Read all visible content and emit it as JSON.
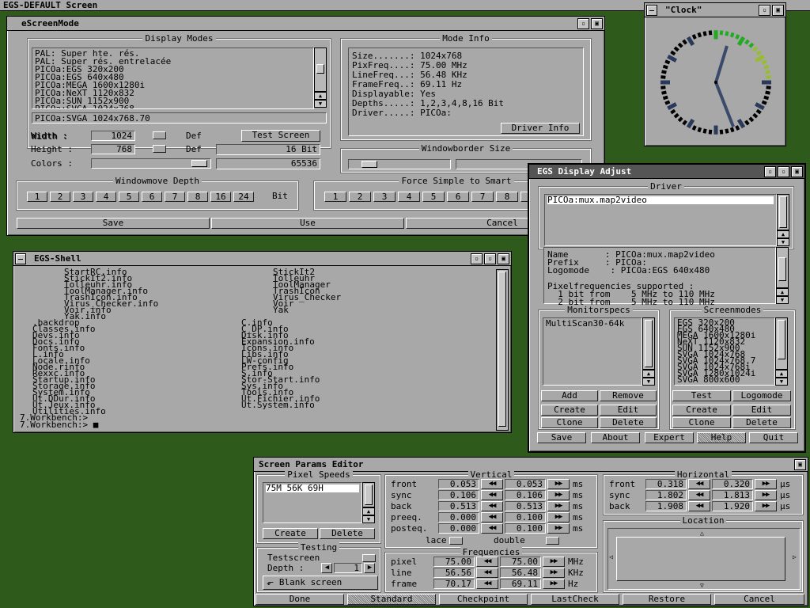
{
  "screen_title": "EGS-DEFAULT Screen",
  "escreenmode": {
    "title": "eScreenMode",
    "display_modes_label": "Display Modes",
    "modes": [
      "PAL: Super hte. rés.",
      "PAL: Super rés. entrelacée",
      "PICOa:EGS 320x200",
      "PICOa:EGS 640x480",
      "PICOa:MEGA 1600x1280i",
      "PICOa:NeXT 1120x832",
      "PICOa:SUN 1152x900",
      "PICOa:SVGA 1024x768",
      "PICOa:SVGA 1024x768.70"
    ],
    "selected_mode": "PICOa:SVGA 1024x768.70",
    "width_label": "Width  :",
    "width_value": "1024",
    "height_label": "Height :",
    "height_value": "768",
    "def_label": "Def",
    "colors_label": "Colors :",
    "test_screen": "Test Screen",
    "bits": "16 Bit",
    "colors_value": "65536",
    "mode_info_label": "Mode Info",
    "info": [
      "Size.......: 1024x768",
      "PixFreq....:  75.00 MHz",
      "LineFreq...:  56.48 KHz",
      "FrameFreq..:  69.11 Hz",
      "Displayable: Yes",
      "Depths.....: 1,2,3,4,8,16 Bit",
      "Driver.....: PICOa:"
    ],
    "driver_info": "Driver Info",
    "windowborder_label": "Windowborder Size",
    "windowmove_label": "Windowmove Depth",
    "depths": [
      "1",
      "2",
      "3",
      "4",
      "5",
      "6",
      "7",
      "8",
      "16",
      "24"
    ],
    "bit_label": "Bit",
    "force_label": "Force Simple to Smart",
    "force_depths": [
      "1",
      "2",
      "3",
      "4",
      "5",
      "6",
      "7",
      "8",
      "1"
    ],
    "save": "Save",
    "use": "Use",
    "cancel": "Cancel"
  },
  "clock": {
    "title": "\"Clock\""
  },
  "shell": {
    "title": "EGS-Shell",
    "col1": [
      "StartRC.info",
      "StickIt2.info",
      "Tolleuhr.info",
      "ToolManager.info",
      "TrashIcon.info",
      "Virus_Checker.info",
      "Voir.info",
      "Yak.info"
    ],
    "col2": [
      "StickIt2",
      "Tolleuhr",
      "ToolManager",
      "TrashIcon",
      "Virus_Checker",
      "Voir",
      "Yak"
    ],
    "col3": [
      ".backdrop",
      "Classes.info",
      "Devs.info",
      "Docs.info",
      "Fonts.info",
      "L.info",
      "Locale.info",
      "Node.rinfo",
      "Rexxc.info",
      "Startup.info",
      "Storage.info",
      "System.info",
      "Ut.DDur.info",
      "Ut.Jeux.info",
      "Utilities.info"
    ],
    "col4": [
      "C.info",
      "C_DP.info",
      "Disk.info",
      "Expansion.info",
      "Icons.info",
      "Libs.info",
      "LW-config",
      "Prefs.info",
      "S.info",
      "Stor-Start.info",
      "Sys.info",
      "Tools.info",
      "Ut.Fichier.info",
      "Ut.System.info"
    ],
    "prompt1": "7.Workbench:>",
    "prompt2": "7.Workbench:> ■"
  },
  "egsadj": {
    "title": "EGS Display Adjust",
    "driver_label": "Driver",
    "driver_item": "PICOa:mux.map2video",
    "details": [
      "Name       : PICOa:mux.map2video",
      "Prefix     : PICOa:",
      "Logomode    : PICOa:EGS 640x480",
      "",
      "Pixelfrequencies supported :",
      "  1 bit from    5 MHz to 110 MHz",
      "  2 bit from    5 MHz to 110 MHz"
    ],
    "monitorspecs_label": "Monitorspecs",
    "monitor_item": "MultiScan30-64k",
    "screenmodes_label": "Screenmodes",
    "screenmodes": [
      "EGS 320x200",
      "EGS 640x480",
      "MEGA 1600x1280i",
      "NeXT 1120x832",
      "SUN 1152x900",
      "SVGA 1024x768",
      "SVGA 1024x768.7",
      "SVGA 1024x768i",
      "SVGA 1280x1024i",
      "SVGA 800x600"
    ],
    "add": "Add",
    "remove": "Remove",
    "create": "Create",
    "edit": "Edit",
    "clone": "Clone",
    "delete": "Delete",
    "test": "Test",
    "logomode": "Logomode",
    "save": "Save",
    "about": "About",
    "expert": "Expert",
    "help": "Help",
    "quit": "Quit"
  },
  "params": {
    "title": "Screen Params Editor",
    "pixel_speeds_label": "Pixel Speeds",
    "speed_item": "75M 56K  69H",
    "create": "Create",
    "delete": "Delete",
    "testing_label": "Testing",
    "testscreen": "Testscreen",
    "depth_label": "Depth :",
    "depth_value": "1",
    "blank": "Blank screen",
    "vertical_label": "Vertical",
    "vrows": [
      {
        "l": "front",
        "a": "0.053",
        "b": "0.053"
      },
      {
        "l": "sync",
        "a": "0.106",
        "b": "0.106"
      },
      {
        "l": "back",
        "a": "0.513",
        "b": "0.513"
      },
      {
        "l": "preeq.",
        "a": "0.000",
        "b": "0.100"
      },
      {
        "l": "posteq.",
        "a": "0.000",
        "b": "0.100"
      }
    ],
    "ms": "ms",
    "lace": "lace",
    "double": "double",
    "horizontal_label": "Horizontal",
    "hrows": [
      {
        "l": "front",
        "a": "0.318",
        "b": "0.320"
      },
      {
        "l": "sync",
        "a": "1.802",
        "b": "1.813"
      },
      {
        "l": "back",
        "a": "1.908",
        "b": "1.920"
      }
    ],
    "us": "µs",
    "location_label": "Location",
    "frequencies_label": "Frequencies",
    "frows": [
      {
        "l": "pixel",
        "a": "75.00",
        "b": "75.00",
        "u": "MHz"
      },
      {
        "l": "line",
        "a": "56.56",
        "b": "56.48",
        "u": "KHz"
      },
      {
        "l": "frame",
        "a": "70.17",
        "b": "69.11",
        "u": "Hz"
      }
    ],
    "done": "Done",
    "standard": "Standard",
    "checkpoint": "Checkpoint",
    "lastcheck": "LastCheck",
    "restore": "Restore",
    "cancel": "Cancel"
  }
}
